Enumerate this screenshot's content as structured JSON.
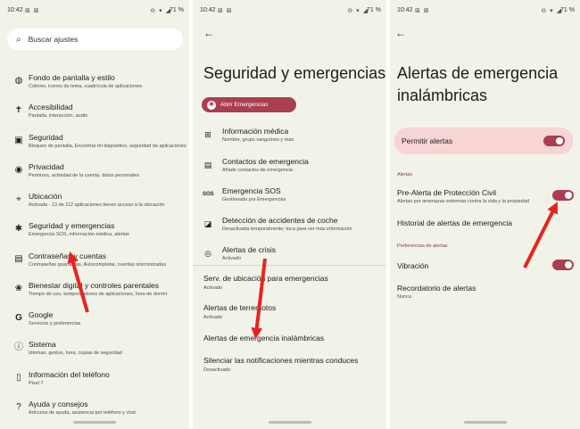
{
  "status": {
    "time": "10:42",
    "battery": "71 %"
  },
  "screen1": {
    "search_placeholder": "Buscar ajustes",
    "items": [
      {
        "title": "Fondo de pantalla y estilo",
        "subtitle": "Colores, iconos de tema, cuadrícula de aplicaciones",
        "icon": "palette-icon"
      },
      {
        "title": "Accesibilidad",
        "subtitle": "Pantalla, interacción, audio",
        "icon": "accessibility-icon"
      },
      {
        "title": "Seguridad",
        "subtitle": "Bloqueo de pantalla, Encontrar mi dispositivo, seguridad de aplicaciones",
        "icon": "lock-icon"
      },
      {
        "title": "Privacidad",
        "subtitle": "Permisos, actividad de la cuenta, datos personales",
        "icon": "eye-icon"
      },
      {
        "title": "Ubicación",
        "subtitle": "Activada - 13 de 112 aplicaciones tienen acceso a la ubicación",
        "icon": "location-pin-icon"
      },
      {
        "title": "Seguridad y emergencias",
        "subtitle": "Emergencia SOS, información médica, alertas",
        "icon": "asterisk-icon"
      },
      {
        "title": "Contraseñas y cuentas",
        "subtitle": "Contraseñas guardadas, Autocompletar, cuentas sincronizadas",
        "icon": "account-box-icon"
      },
      {
        "title": "Bienestar digital y controles parentales",
        "subtitle": "Tiempo de uso, temporizadores de aplicaciones, hora de dormir",
        "icon": "wellbeing-icon"
      },
      {
        "title": "Google",
        "subtitle": "Servicios y preferencias",
        "icon": "google-icon"
      },
      {
        "title": "Sistema",
        "subtitle": "Idiomas, gestos, hora, copias de seguridad",
        "icon": "info-icon"
      },
      {
        "title": "Información del teléfono",
        "subtitle": "Pixel 7",
        "icon": "phone-icon"
      },
      {
        "title": "Ayuda y consejos",
        "subtitle": "Artículos de ayuda, asistencia por teléfono y chat",
        "icon": "help-icon"
      }
    ]
  },
  "screen2": {
    "title": "Seguridad y emergencias",
    "open_button": "Abrir Emergencias",
    "items": [
      {
        "title": "Información médica",
        "subtitle": "Nombre, grupo sanguíneo y más",
        "icon": "medical-kit-icon"
      },
      {
        "title": "Contactos de emergencia",
        "subtitle": "Añade contactos de emergencia",
        "icon": "contacts-icon"
      },
      {
        "title": "Emergencia SOS",
        "subtitle": "Gestionado por Emergencias",
        "icon": "sos-icon"
      },
      {
        "title": "Detección de accidentes de coche",
        "subtitle": "Desactivada temporalmente; toca para ver más información",
        "icon": "car-crash-icon"
      },
      {
        "title": "Alertas de crisis",
        "subtitle": "Activado",
        "icon": "crisis-alert-icon"
      }
    ],
    "plain_items": [
      {
        "title": "Serv. de ubicación para emergencias",
        "subtitle": "Activado"
      },
      {
        "title": "Alertas de terremotos",
        "subtitle": "Activado"
      },
      {
        "title": "Alertas de emergencia inalámbricas",
        "subtitle": ""
      },
      {
        "title": "Silenciar las notificaciones mientras conduces",
        "subtitle": "Desactivado"
      }
    ]
  },
  "screen3": {
    "title": "Alertas de emergencia inalámbricas",
    "allow_alerts": "Permitir alertas",
    "section_alerts": "Alertas",
    "pre_alert_title": "Pre-Alerta de Protección Civil",
    "pre_alert_subtitle": "Alertas por amenazas extremas contra la vida y la propiedad",
    "history": "Historial de alertas de emergencia",
    "section_prefs": "Preferencias de alertas",
    "vibration": "Vibración",
    "reminder_title": "Recordatorio de alertas",
    "reminder_subtitle": "Nunca"
  },
  "colors": {
    "accent": "#a93f50",
    "arrow": "#e8231f",
    "background": "#f1f3e9",
    "card": "#f7d5d5"
  }
}
